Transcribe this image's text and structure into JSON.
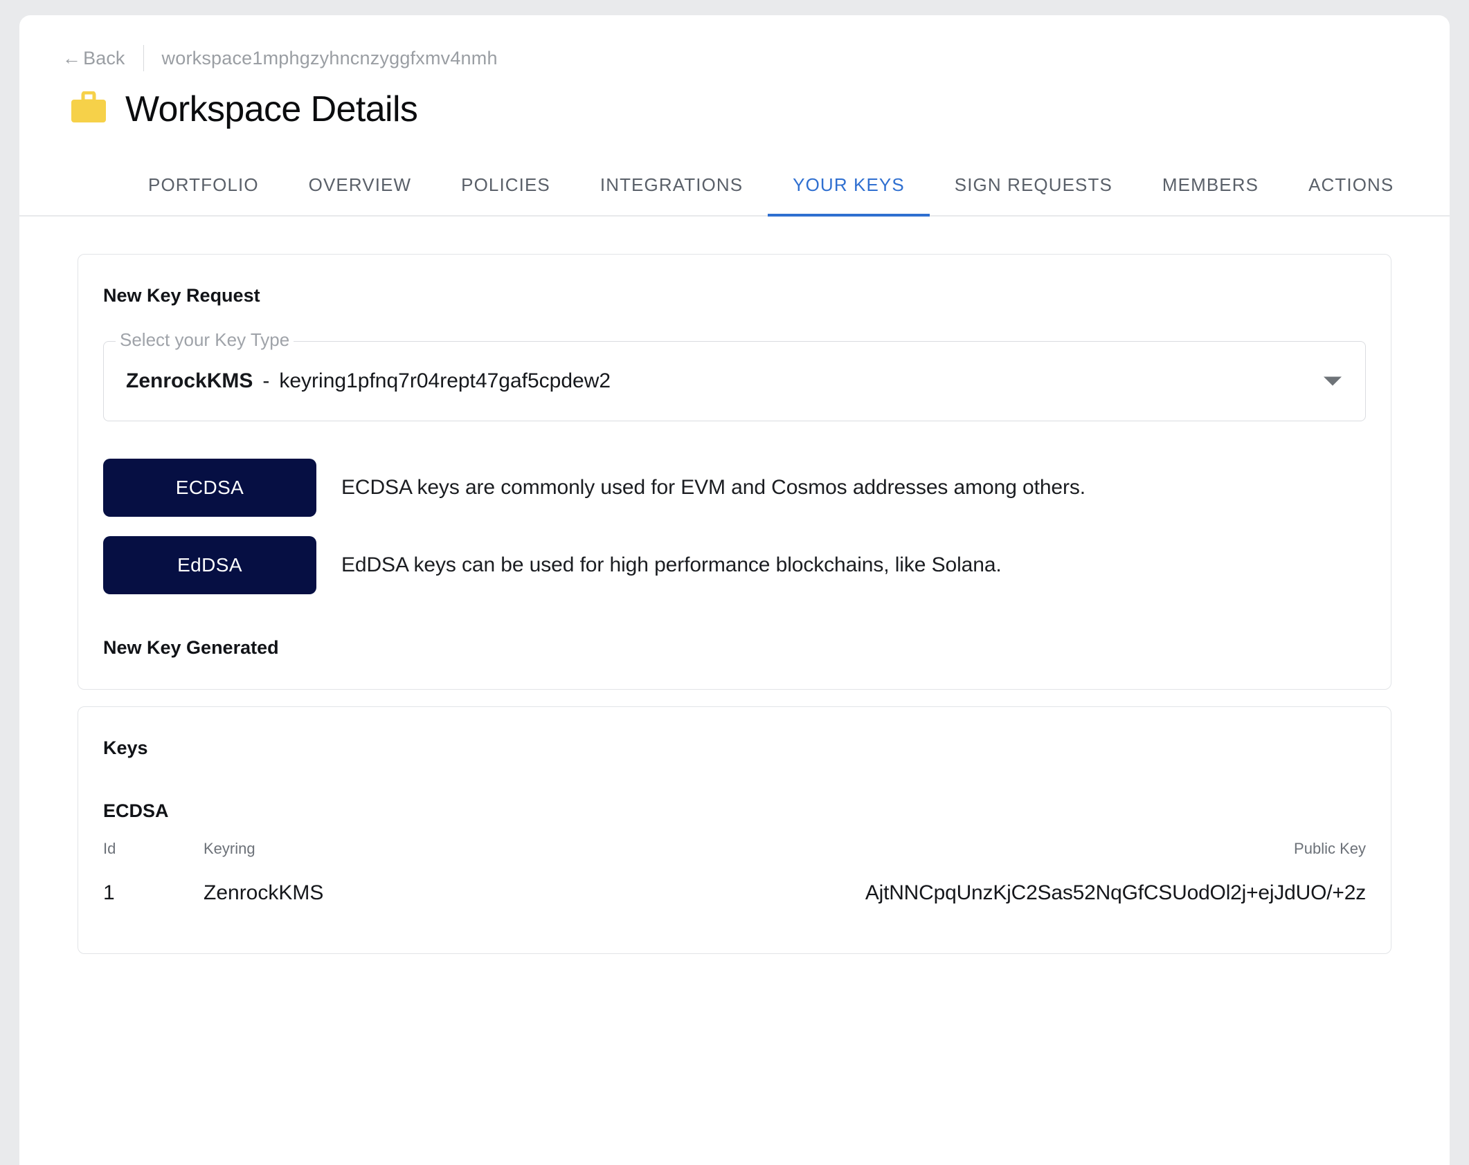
{
  "breadcrumb": {
    "back_label": "Back",
    "back_arrow": "←",
    "workspace_id": "workspace1mphgzyhncnzyggfxmv4nmh"
  },
  "header": {
    "title": "Workspace Details",
    "icon": "briefcase-icon",
    "icon_color": "#F6D149"
  },
  "tabs": {
    "active": "YOUR KEYS",
    "accent_color": "#2F6FD0",
    "items": [
      {
        "label": "PORTFOLIO",
        "active": false
      },
      {
        "label": "OVERVIEW",
        "active": false
      },
      {
        "label": "POLICIES",
        "active": false
      },
      {
        "label": "INTEGRATIONS",
        "active": false
      },
      {
        "label": "YOUR KEYS",
        "active": true
      },
      {
        "label": "SIGN REQUESTS",
        "active": false
      },
      {
        "label": "MEMBERS",
        "active": false
      },
      {
        "label": "ACTIONS",
        "active": false
      }
    ]
  },
  "new_key_request": {
    "heading": "New Key Request",
    "select": {
      "label": "Select your Key Type",
      "value_bold": "ZenrockKMS",
      "value_separator": "-",
      "value_rest": "keyring1pfnq7r04rept47gaf5cpdew2",
      "caret_icon": "chevron-down-icon"
    },
    "key_types": [
      {
        "button_label": "ECDSA",
        "description": "ECDSA keys are commonly used for EVM and Cosmos addresses among others.",
        "button_color": "#060F43"
      },
      {
        "button_label": "EdDSA",
        "description": "EdDSA keys can be used for high performance blockchains, like Solana.",
        "button_color": "#060F43"
      }
    ],
    "generated_heading": "New Key Generated"
  },
  "keys_card": {
    "heading": "Keys",
    "group_heading": "ECDSA",
    "columns": [
      "Id",
      "Keyring",
      "Public Key"
    ],
    "rows": [
      {
        "id": "1",
        "keyring": "ZenrockKMS",
        "public_key": "AjtNNCpqUnzKjC2Sas52NqGfCSUodOl2j+ejJdUO/+2z"
      }
    ]
  }
}
